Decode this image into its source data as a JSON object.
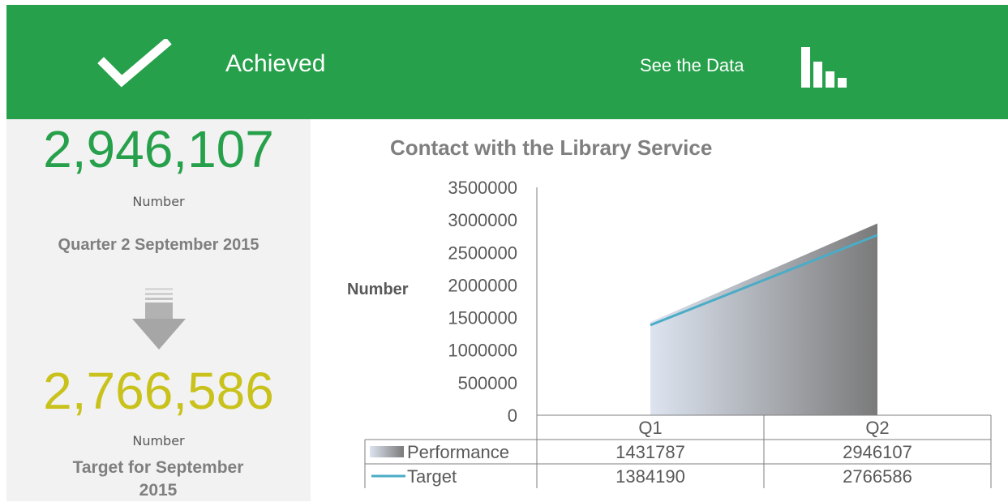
{
  "header": {
    "status_label": "Achieved",
    "see_data_label": "See the Data",
    "background_color": "#26a04a"
  },
  "summary": {
    "performance_value": "2,946,107",
    "performance_unit": "Number",
    "performance_period": "Quarter 2 September 2015",
    "target_value": "2,766,586",
    "target_unit": "Number",
    "target_period": "Target for September 2015",
    "performance_color": "#26a04a",
    "target_color": "#c9c21c"
  },
  "chart_data": {
    "type": "area",
    "title": "Contact with the Library Service",
    "ylabel": "Number",
    "xlabel": "",
    "categories": [
      "Q1",
      "Q2"
    ],
    "ylim": [
      0,
      3500000
    ],
    "yticks": [
      "0",
      "500000",
      "1000000",
      "1500000",
      "2000000",
      "2500000",
      "3000000",
      "3500000"
    ],
    "series": [
      {
        "name": "Performance",
        "type": "area",
        "values": [
          1431787,
          2946107
        ]
      },
      {
        "name": "Target",
        "type": "line",
        "values": [
          1384190,
          2766586
        ]
      }
    ],
    "data_table": true,
    "gridlines": false,
    "colors": {
      "performance_start": "#dde4f0",
      "performance_end": "#7a7a7a",
      "target_line": "#4bacc6"
    }
  }
}
